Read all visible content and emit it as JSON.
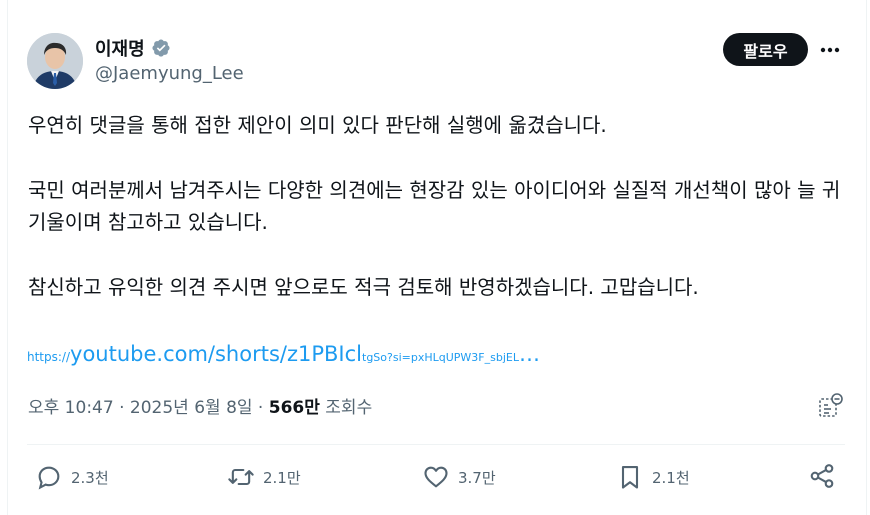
{
  "author": {
    "name": "이재명",
    "handle": "@Jaemyung_Lee",
    "verified": true,
    "verified_color": "#829aab"
  },
  "actions_top": {
    "follow_label": "팔로우",
    "more_icon": "more-horizontal-icon"
  },
  "post": {
    "paragraphs": [
      "우연히 댓글을 통해 접한 제안이 의미 있다 판단해 실행에 옮겼습니다.",
      "국민 여러분께서 남겨주시는 다양한 의견에는 현장감 있는 아이디어와 실질적 개선책이 많아 늘 귀 기울이며 참고하고 있습니다.",
      "참신하고 유익한 의견 주시면 앞으로도 적극 검토해 반영하겠습니다. 고맙습니다."
    ],
    "link": {
      "protocol": "https://",
      "main": "youtube.com/shorts/z1PBIcl",
      "rest": "tgSo?si=pxHLqUPW3F_sbjEL",
      "ellipsis": "…"
    }
  },
  "meta": {
    "time": "오후 10:47",
    "sep1": " · ",
    "date": "2025년 6월 8일",
    "sep2": " · ",
    "views": "566만",
    "views_label": " 조회수"
  },
  "stats": {
    "replies": "2.3천",
    "reposts": "2.1만",
    "likes": "3.7만",
    "bookmarks": "2.1천"
  },
  "colors": {
    "link": "#1d9bf0",
    "secondary_text": "#536471",
    "primary_text": "#0f1419",
    "button_bg": "#0f1419"
  }
}
